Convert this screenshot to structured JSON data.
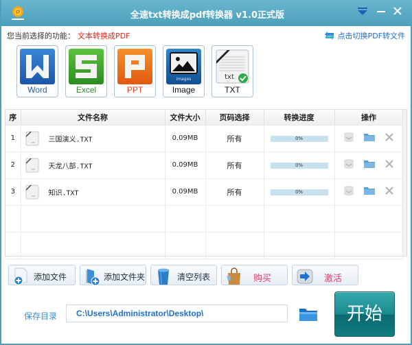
{
  "window": {
    "title": "全速txt转换成pdf转换器 v1.0正式版",
    "controls": [
      "menu",
      "minimize",
      "close"
    ]
  },
  "function_bar": {
    "label": "您当前选择的功能：",
    "value": "文本转换成PDF",
    "switch_link": "点击切换PDF转文件"
  },
  "type_tiles": [
    {
      "label": "Word",
      "icon": "word-icon",
      "color": "#1f5fb8",
      "selected": false
    },
    {
      "label": "Excel",
      "icon": "excel-icon",
      "color": "#2e8b30",
      "selected": false
    },
    {
      "label": "PPT",
      "icon": "ppt-icon",
      "color": "#e8431a",
      "selected": false
    },
    {
      "label": "Image",
      "icon": "image-icon",
      "color": "#111111",
      "selected": false
    },
    {
      "label": "TXT",
      "icon": "txt-icon",
      "color": "#111111",
      "selected": true
    }
  ],
  "table": {
    "columns": [
      "序",
      "文件名称",
      "文件大小",
      "页码选择",
      "转换进度",
      "操作"
    ],
    "rows": [
      {
        "index": "1",
        "name": "三国演义.TXT",
        "size": "0.09MB",
        "pages": "所有",
        "progress": 0,
        "progress_text": "0%"
      },
      {
        "index": "2",
        "name": "天龙八部.TXT",
        "size": "0.09MB",
        "pages": "所有",
        "progress": 0,
        "progress_text": "0%"
      },
      {
        "index": "3",
        "name": "知识.TXT",
        "size": "0.09MB",
        "pages": "所有",
        "progress": 0,
        "progress_text": "0%"
      }
    ]
  },
  "actions": {
    "add_file": "添加文件",
    "add_folder": "添加文件夹",
    "clear_list": "清空列表",
    "buy": "购买",
    "activate": "激活"
  },
  "save": {
    "label": "保存目录",
    "path": "C:\\Users\\Administrator\\Desktop\\"
  },
  "start_button": "开始",
  "colors": {
    "titlebar": "#5aaac5",
    "accent_red": "#e8231a",
    "link_blue": "#1f6fd0",
    "start_teal": "#1a8a90"
  }
}
